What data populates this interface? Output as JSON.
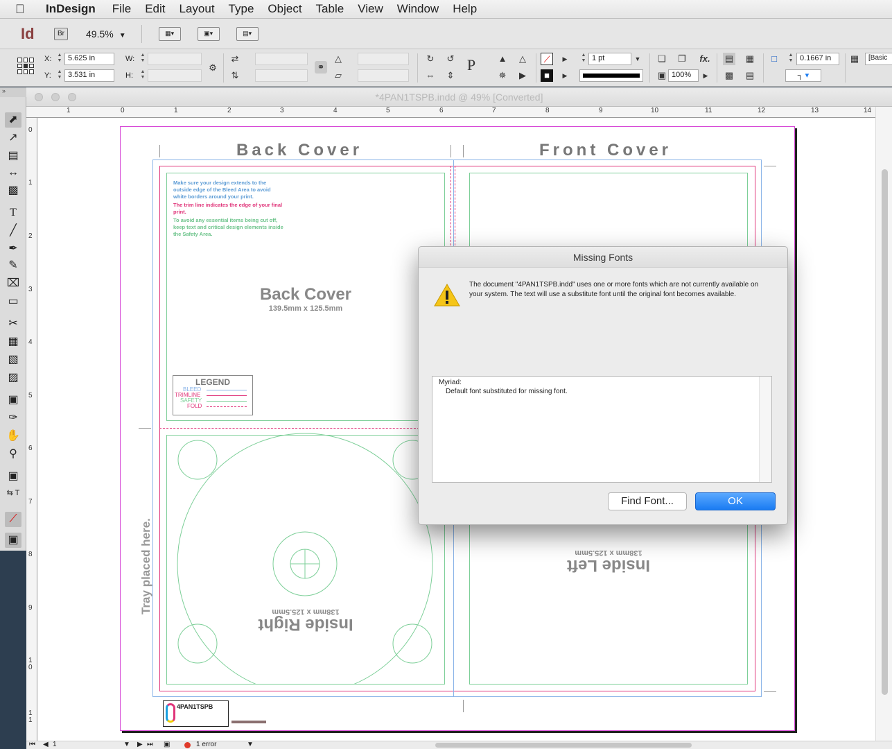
{
  "menubar": {
    "app": "InDesign",
    "items": [
      "File",
      "Edit",
      "Layout",
      "Type",
      "Object",
      "Table",
      "View",
      "Window",
      "Help"
    ]
  },
  "appbar": {
    "logo": "Id",
    "bridge": "Br",
    "zoom": "49.5%"
  },
  "control": {
    "x_label": "X:",
    "y_label": "Y:",
    "w_label": "W:",
    "h_label": "H:",
    "x_value": "5.625 in",
    "y_value": "3.531 in",
    "stroke_weight": "1 pt",
    "opacity": "100%",
    "corner_size": "0.1667 in",
    "style": "[Basic",
    "fx": "fx."
  },
  "document": {
    "title": "*4PAN1TSPB.indd @ 49% [Converted]",
    "ruler_h": [
      "1",
      "0",
      "1",
      "2",
      "3",
      "4",
      "5",
      "6",
      "7",
      "8",
      "9",
      "10",
      "11",
      "12",
      "13",
      "14"
    ],
    "ruler_v": [
      "0",
      "1",
      "2",
      "3",
      "4",
      "5",
      "6",
      "7",
      "8",
      "9",
      "1\n0",
      "1\n1"
    ],
    "page_number": "1",
    "status": "1 error"
  },
  "artwork": {
    "back_cover_header": "Back Cover",
    "front_cover_header": "Front Cover",
    "back_cover_title": "Back Cover",
    "back_cover_dims": "139.5mm x 125.5mm",
    "notes": [
      {
        "text": "Make sure your design extends to the outside edge of the Bleed Area to avoid white borders around your print.",
        "color": "#5b9bd5"
      },
      {
        "text": "The trim line indicates the edge of your final print.",
        "color": "#e0357a"
      },
      {
        "text": "To avoid any essential items being cut off, keep text and critical design elements inside the Safety Area.",
        "color": "#6cc38a"
      }
    ],
    "legend_title": "LEGEND",
    "legend": [
      {
        "label": "BLEED",
        "color": "#8ab4e8"
      },
      {
        "label": "TRIMLINE",
        "color": "#e0357a"
      },
      {
        "label": "SAFETY",
        "color": "#7dcf98"
      },
      {
        "label": "FOLD",
        "color": "#e0357a"
      }
    ],
    "inside_right_title": "Inside Right",
    "inside_right_dims": "138mm x 125.5mm",
    "inside_left_title": "Inside Left",
    "inside_left_dims": "138mm x 125.5mm",
    "tray": "Tray placed here.",
    "logo": "4PAN1TSPB"
  },
  "dialog": {
    "title": "Missing Fonts",
    "message": "The document \"4PAN1TSPB.indd\" uses one or more fonts which are not currently available on your system. The text will use a substitute font until the original font becomes available.",
    "font_name": "Myriad:",
    "font_note": "Default font substituted for missing font.",
    "find_font": "Find Font...",
    "ok": "OK"
  },
  "colors": {
    "trim": "#e0357a",
    "bleed": "#8ab4e8",
    "safety": "#7dcf98",
    "ok_button": "#1a7cf2"
  }
}
